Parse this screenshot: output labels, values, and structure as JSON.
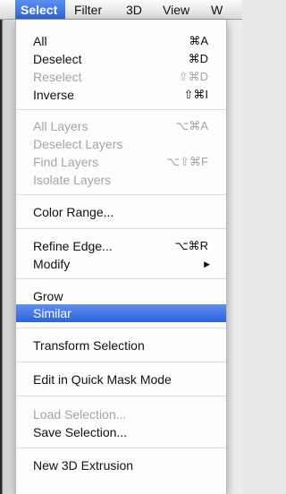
{
  "menubar": {
    "items": [
      "Select",
      "Filter",
      "3D",
      "View",
      "W"
    ]
  },
  "menu": {
    "items": [
      {
        "label": "All",
        "shortcut": "⌘A",
        "enabled": true
      },
      {
        "label": "Deselect",
        "shortcut": "⌘D",
        "enabled": true
      },
      {
        "label": "Reselect",
        "shortcut": "⇧⌘D",
        "enabled": false
      },
      {
        "label": "Inverse",
        "shortcut": "⇧⌘I",
        "enabled": true
      },
      {
        "label": "All Layers",
        "shortcut": "⌥⌘A",
        "enabled": false
      },
      {
        "label": "Deselect Layers",
        "shortcut": "",
        "enabled": false
      },
      {
        "label": "Find Layers",
        "shortcut": "⌥⇧⌘F",
        "enabled": false
      },
      {
        "label": "Isolate Layers",
        "shortcut": "",
        "enabled": false
      },
      {
        "label": "Color Range...",
        "shortcut": "",
        "enabled": true
      },
      {
        "label": "Refine Edge...",
        "shortcut": "⌥⌘R",
        "enabled": true
      },
      {
        "label": "Modify",
        "shortcut": "",
        "enabled": true,
        "submenu": true
      },
      {
        "label": "Grow",
        "shortcut": "",
        "enabled": true
      },
      {
        "label": "Similar",
        "shortcut": "",
        "enabled": true,
        "highlighted": true
      },
      {
        "label": "Transform Selection",
        "shortcut": "",
        "enabled": true
      },
      {
        "label": "Edit in Quick Mask Mode",
        "shortcut": "",
        "enabled": true
      },
      {
        "label": "Load Selection...",
        "shortcut": "",
        "enabled": false
      },
      {
        "label": "Save Selection...",
        "shortcut": "",
        "enabled": true
      },
      {
        "label": "New 3D Extrusion",
        "shortcut": "",
        "enabled": true
      }
    ],
    "submenu_arrow_icon": "triangle-right-icon",
    "highlight_color": "#3a6fe0"
  }
}
